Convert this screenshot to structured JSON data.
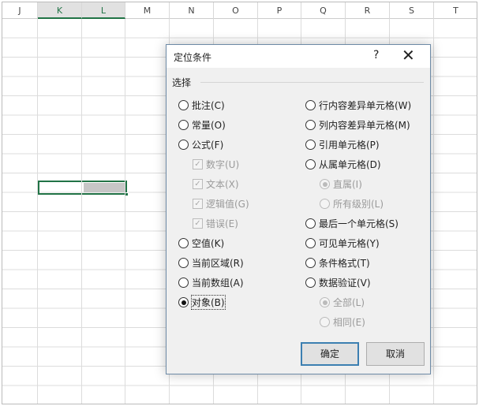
{
  "sheet": {
    "columns": [
      "J",
      "K",
      "L",
      "M",
      "N",
      "O",
      "P",
      "Q",
      "R",
      "S",
      "T"
    ],
    "selected_columns": [
      "K",
      "L"
    ]
  },
  "dialog": {
    "title": "定位条件",
    "help": "?",
    "close": "✕",
    "group_label": "选择",
    "left": [
      {
        "type": "radio",
        "label": "批注(C)"
      },
      {
        "type": "radio",
        "label": "常量(O)"
      },
      {
        "type": "radio",
        "label": "公式(F)"
      },
      {
        "type": "check",
        "label": "数字(U)",
        "checked": true,
        "disabled": true
      },
      {
        "type": "check",
        "label": "文本(X)",
        "checked": true,
        "disabled": true
      },
      {
        "type": "check",
        "label": "逻辑值(G)",
        "checked": true,
        "disabled": true
      },
      {
        "type": "check",
        "label": "错误(E)",
        "checked": true,
        "disabled": true
      },
      {
        "type": "radio",
        "label": "空值(K)"
      },
      {
        "type": "radio",
        "label": "当前区域(R)"
      },
      {
        "type": "radio",
        "label": "当前数组(A)"
      },
      {
        "type": "radio",
        "label": "对象(B)",
        "checked": true,
        "focus": true
      }
    ],
    "right": [
      {
        "type": "radio",
        "label": "行内容差异单元格(W)"
      },
      {
        "type": "radio",
        "label": "列内容差异单元格(M)"
      },
      {
        "type": "radio",
        "label": "引用单元格(P)"
      },
      {
        "type": "radio",
        "label": "从属单元格(D)"
      },
      {
        "type": "radio",
        "label": "直属(I)",
        "checked": true,
        "disabled": true,
        "sub": true
      },
      {
        "type": "radio",
        "label": "所有级别(L)",
        "disabled": true,
        "sub": true
      },
      {
        "type": "radio",
        "label": "最后一个单元格(S)"
      },
      {
        "type": "radio",
        "label": "可见单元格(Y)"
      },
      {
        "type": "radio",
        "label": "条件格式(T)"
      },
      {
        "type": "radio",
        "label": "数据验证(V)"
      },
      {
        "type": "radio",
        "label": "全部(L)",
        "checked": true,
        "disabled": true,
        "sub": true
      },
      {
        "type": "radio",
        "label": "相同(E)",
        "disabled": true,
        "sub": true
      }
    ],
    "ok": "确定",
    "cancel": "取消"
  }
}
